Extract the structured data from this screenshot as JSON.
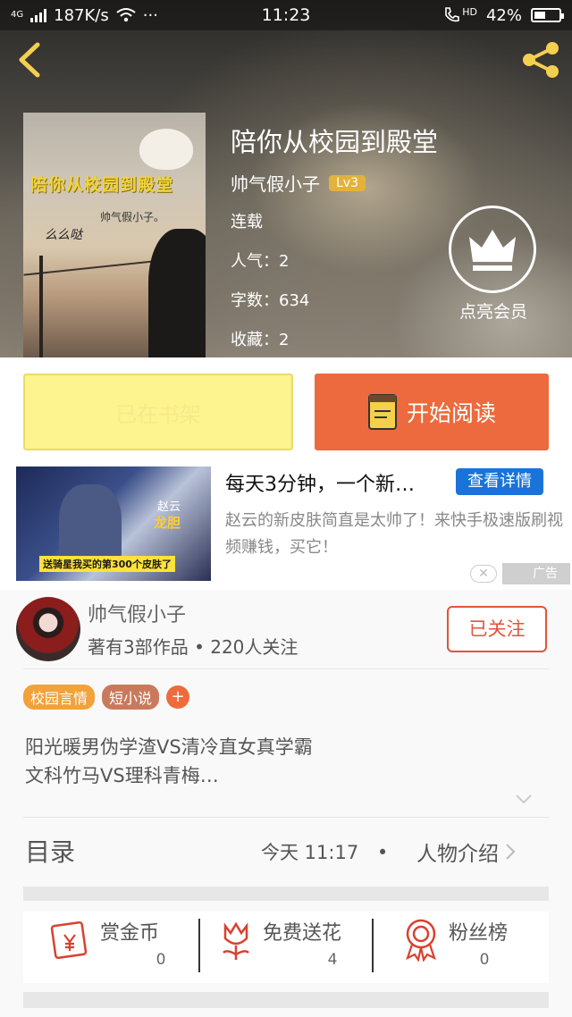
{
  "status_bar": {
    "network": "4G",
    "speed": "187K/s",
    "more": "···",
    "time": "11:23",
    "hd": "HD",
    "battery": "42%"
  },
  "book": {
    "title": "陪你从校园到殿堂",
    "author": "帅气假小子",
    "level": "Lv3",
    "status": "连载",
    "popularity": "人气：2",
    "word_count": "字数：634",
    "favorites": "收藏：2",
    "cover": {
      "title": "陪你从校园到殿堂",
      "author": "帅气假小子。",
      "handwriting": "么么哒"
    }
  },
  "vip": {
    "label": "点亮会员"
  },
  "actions": {
    "shelf_label": "已在书架",
    "read_label": "开始阅读"
  },
  "ad": {
    "title": "每天3分钟，一个新…",
    "detail_button": "查看详情",
    "description": "赵云的新皮肤简直是太帅了！来快手极速版刷视频赚钱，买它！",
    "image_caption": "送骑星我买的第300个皮肤了",
    "hero_name": "赵云",
    "hero_skin": "龙胆",
    "label": "广告",
    "close": "✕"
  },
  "author_section": {
    "name": "帅气假小子",
    "stats": "著有3部作品 • 220人关注",
    "follow_label": "已关注"
  },
  "tags": [
    {
      "label": "校园言情",
      "color": "#f2a23a"
    },
    {
      "label": "短小说",
      "color": "#c97a5c"
    }
  ],
  "tag_add": "+",
  "intro": {
    "line1": "阳光暖男伪学渣VS清冷直女真学霸",
    "line2": "文科竹马VS理科青梅…"
  },
  "catalog": {
    "label": "目录",
    "updated": "今天  11:17",
    "separator": "•",
    "characters_link": "人物介绍"
  },
  "rewards": [
    {
      "label": "赏金币",
      "count": "0",
      "icon": "coin-envelope-icon"
    },
    {
      "label": "免费送花",
      "count": "4",
      "icon": "flower-icon"
    },
    {
      "label": "粉丝榜",
      "count": "0",
      "icon": "medal-icon"
    }
  ],
  "colors": {
    "accent_orange": "#ec6a3d",
    "shelf_yellow": "#fdf38f",
    "ad_blue": "#1a73d9",
    "follow_red": "#e2543a",
    "level_gold": "#e2b23b",
    "reward_red": "#d9412f"
  }
}
